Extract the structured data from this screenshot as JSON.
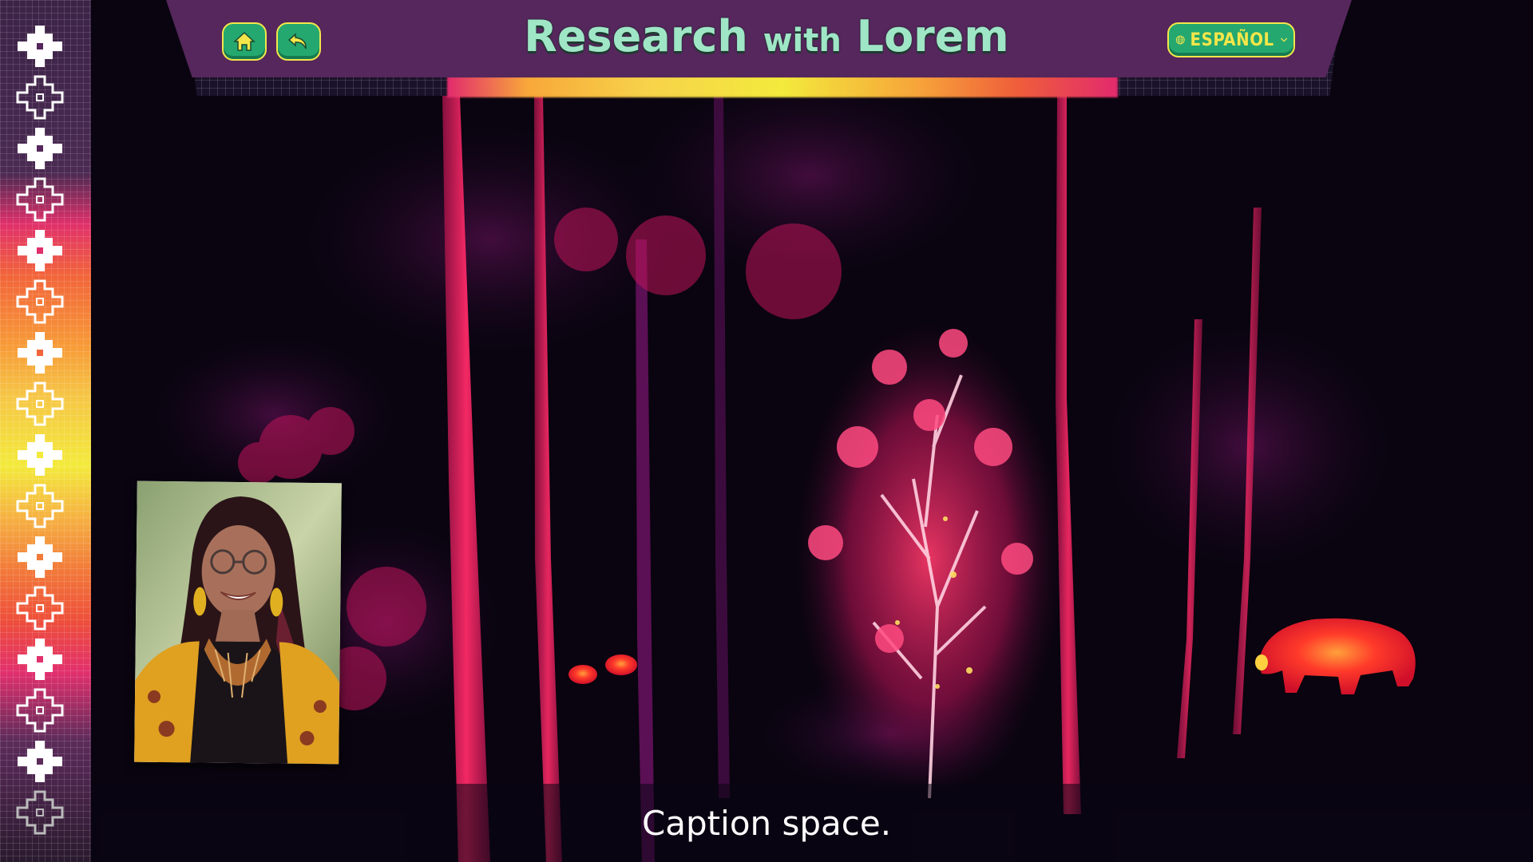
{
  "header": {
    "title_main": "Research",
    "title_with": "with",
    "title_name": "Lorem",
    "language_label": "ESPAÑOL"
  },
  "nav": {
    "home_icon": "home-icon",
    "back_icon": "back-arrow-icon",
    "language_icon": "globe-icon"
  },
  "caption": {
    "text": "Caption space."
  },
  "colors": {
    "header_bg": "#55275c",
    "button_green": "#24a870",
    "button_border": "#f4e64a",
    "title_mint": "#9fe6c6",
    "thermal_hot": "#ff2a3a",
    "thermal_tree": "#e0206a",
    "scene_bg": "#07030f"
  }
}
